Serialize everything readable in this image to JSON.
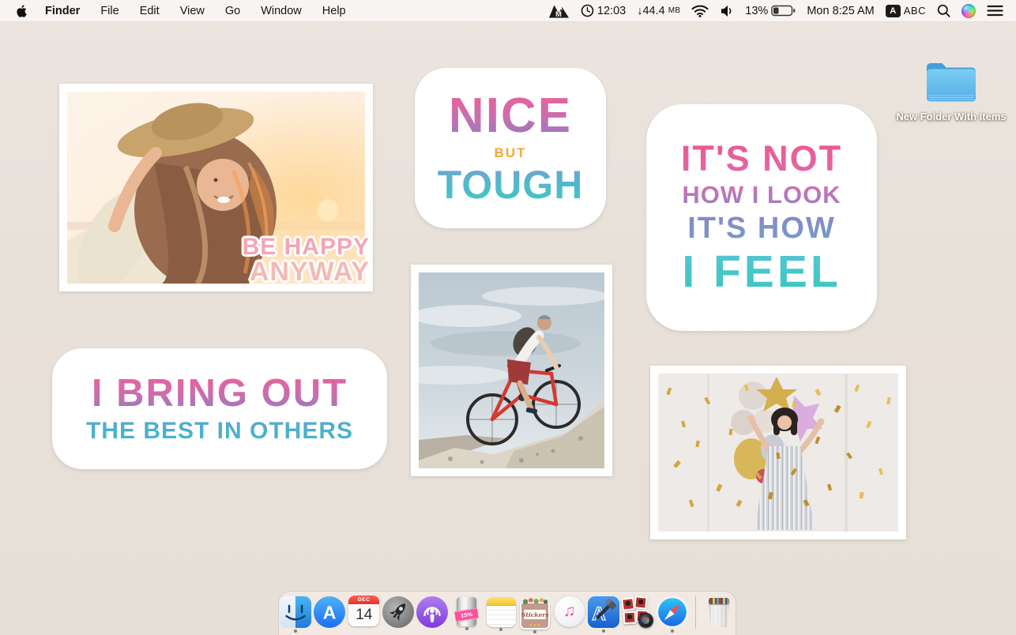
{
  "menu_bar": {
    "app_name": "Finder",
    "menus": [
      "File",
      "Edit",
      "View",
      "Go",
      "Window",
      "Help"
    ],
    "status": {
      "mountain_letter": "M",
      "time": "12:03",
      "bandwidth": "↓44.4",
      "bandwidth_unit": "MB",
      "battery_percent": "13%",
      "datetime": "Mon 8:25 AM",
      "input_badge": "A",
      "input_label": "ABC"
    }
  },
  "desktop": {
    "folder_label": "New Folder With Items",
    "stickers": {
      "be_happy": {
        "line1": "BE HAPPY",
        "line2": "ANYWAY"
      },
      "nice_tough": {
        "line1": "NICE",
        "line2": "BUT",
        "line3": "TOUGH"
      },
      "feel": {
        "line1": "IT'S NOT",
        "line2": "HOW I LOOK",
        "line3": "IT'S HOW",
        "line4": "I FEEL"
      },
      "bring_out": {
        "line1": "I BRING OUT",
        "line2": "THE BEST IN OTHERS"
      }
    }
  },
  "dock": {
    "calendar_month": "DEC",
    "calendar_day": "14",
    "battery_app_label": "15%",
    "stickers_label": "Stickers",
    "app_store_letter": "A",
    "xcode_letter": "A",
    "music_glyph": "♫"
  },
  "colors": {
    "desktop_bg": "#e8e1da",
    "menubar_bg": "#f7f4f2",
    "dock_bg": "#f3ebe4",
    "sticker_pink": "#ee5f95",
    "sticker_purple": "#8f7cc0",
    "sticker_teal": "#3fc3c9",
    "sticker_orange": "#f7a833",
    "folder_blue": "#58b3e6",
    "battery_band_pink": "#ff4f9e",
    "calendar_red": "#e2342c"
  }
}
